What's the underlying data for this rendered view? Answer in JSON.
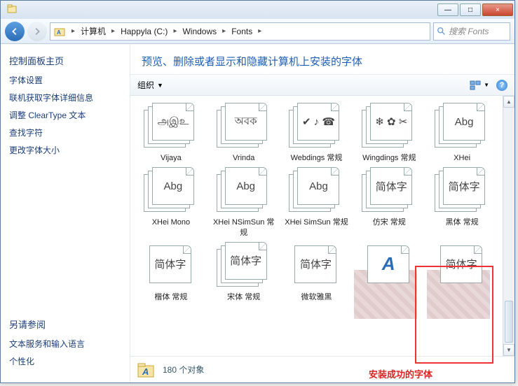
{
  "window": {
    "min": "—",
    "max": "□",
    "close": "×"
  },
  "nav": {
    "breadcrumb": [
      "计算机",
      "Happyla (C:)",
      "Windows",
      "Fonts"
    ],
    "search_placeholder": "搜索 Fonts"
  },
  "sidebar": {
    "heading": "控制面板主页",
    "links": [
      "字体设置",
      "联机获取字体详细信息",
      "调整 ClearType 文本",
      "查找字符",
      "更改字体大小"
    ],
    "see_also_heading": "另请参阅",
    "see_also": [
      "文本服务和输入语言",
      "个性化"
    ]
  },
  "main": {
    "title": "预览、删除或者显示和隐藏计算机上安装的字体",
    "organize": "组织"
  },
  "fonts": [
    {
      "preview": "அஇஉ",
      "label": "Vijaya"
    },
    {
      "preview": "অবক",
      "label": "Vrinda"
    },
    {
      "preview": "✔ ♪ ☎",
      "label": "Webdings 常规"
    },
    {
      "preview": "❄ ✿ ✂",
      "label": "Wingdings 常规"
    },
    {
      "preview": "Abg",
      "label": "XHei"
    },
    {
      "preview": "Abg",
      "label": "XHei Mono"
    },
    {
      "preview": "Abg",
      "label": "XHei NSimSun 常规"
    },
    {
      "preview": "Abg",
      "label": "XHei SimSun 常规"
    },
    {
      "preview": "简体字",
      "label": "仿宋 常规"
    },
    {
      "preview": "简体字",
      "label": "黑体 常规"
    },
    {
      "preview": "简体字",
      "label": "楷体 常规"
    },
    {
      "preview": "简体字",
      "label": "宋体 常规"
    },
    {
      "preview": "简体字",
      "label": "微软雅黑"
    },
    {
      "preview": "A",
      "label": ""
    },
    {
      "preview": "简体字",
      "label": ""
    }
  ],
  "status": {
    "count": "180 个对象"
  },
  "annotation": "安装成功的字体"
}
